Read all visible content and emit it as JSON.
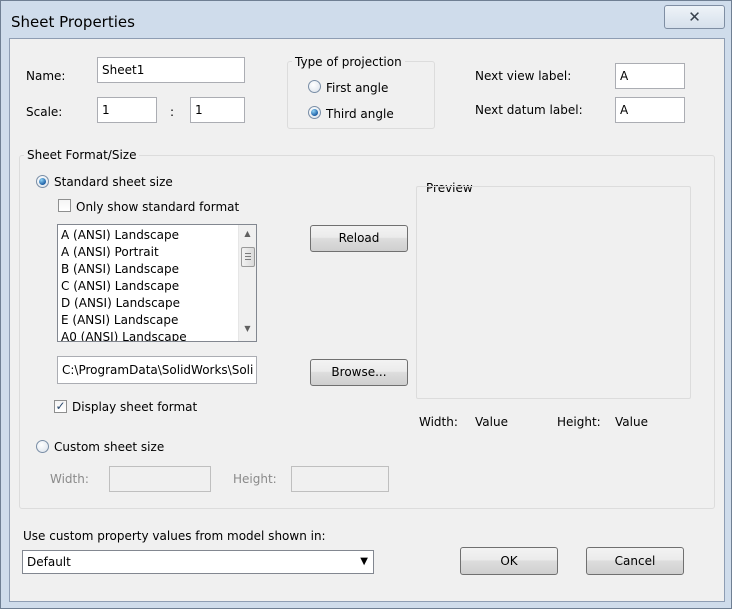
{
  "window": {
    "title": "Sheet Properties",
    "close_glyph": "✕"
  },
  "name": {
    "label": "Name:",
    "value": "Sheet1"
  },
  "scale": {
    "label": "Scale:",
    "numerator": "1",
    "separator": ":",
    "denominator": "1"
  },
  "projection": {
    "legend": "Type of projection",
    "options": [
      {
        "label": "First angle",
        "selected": false
      },
      {
        "label": "Third angle",
        "selected": true
      }
    ]
  },
  "labels": {
    "next_view_label": "Next view label:",
    "next_view_value": "A",
    "next_datum_label": "Next datum label:",
    "next_datum_value": "A"
  },
  "sheet_format": {
    "legend": "Sheet Format/Size",
    "standard_size_label": "Standard sheet size",
    "standard_selected": true,
    "only_standard_label": "Only show standard format",
    "only_standard_checked": false,
    "sizes": [
      "A (ANSI) Landscape",
      "A (ANSI) Portrait",
      "B (ANSI) Landscape",
      "C (ANSI) Landscape",
      "D (ANSI) Landscape",
      "E (ANSI) Landscape",
      "A0 (ANSI) Landscape"
    ],
    "reload_label": "Reload",
    "path_value": "C:\\ProgramData\\SolidWorks\\Soli",
    "browse_label": "Browse...",
    "display_format_label": "Display sheet format",
    "display_format_checked": true,
    "custom_size_label": "Custom sheet size",
    "custom_selected": false,
    "width_label": "Width:",
    "height_label": "Height:"
  },
  "preview": {
    "legend": "Preview",
    "width_label": "Width:",
    "width_value": "Value",
    "height_label": "Height:",
    "height_value": "Value"
  },
  "custom_property": {
    "label": "Use custom property values from model shown in:",
    "selected": "Default"
  },
  "buttons": {
    "ok": "OK",
    "cancel": "Cancel"
  },
  "colors": {
    "frame": "#cfdceb",
    "radio_dot": "#1c5fa6",
    "face": "#f0f0f0"
  }
}
